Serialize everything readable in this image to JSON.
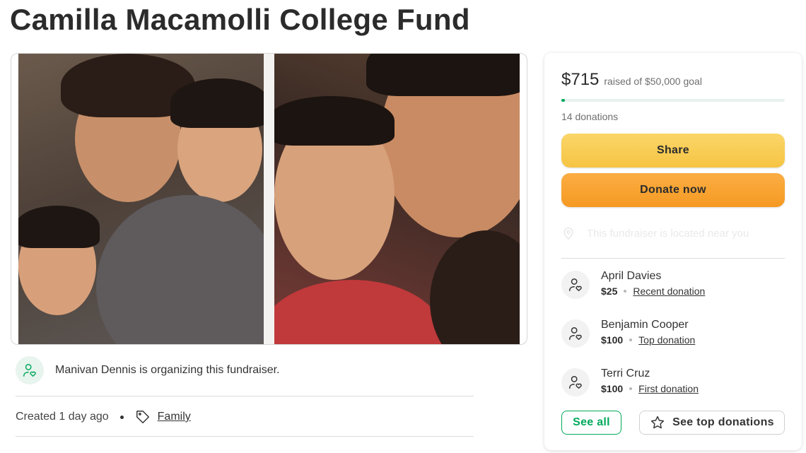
{
  "title": "Camilla Macamolli College Fund",
  "organizer": {
    "text": "Manivan Dennis is organizing this fundraiser."
  },
  "meta": {
    "created": "Created 1 day ago",
    "category": "Family"
  },
  "card": {
    "raised_amount": "$715",
    "raised_goal": "raised of $50,000 goal",
    "progress_fraction": 0.0143,
    "donations_count": "14 donations",
    "share_label": "Share",
    "donate_label": "Donate now",
    "location_text": "This fundraiser is located near you",
    "donors": [
      {
        "name": "April Davies",
        "amount": "$25",
        "kind": "Recent donation"
      },
      {
        "name": "Benjamin Cooper",
        "amount": "$100",
        "kind": "Top donation"
      },
      {
        "name": "Terri Cruz",
        "amount": "$100",
        "kind": "First donation"
      }
    ],
    "see_all_label": "See all",
    "see_top_label": "See top donations"
  },
  "colors": {
    "brand_green": "#02a95c",
    "share_yellow": "#f6c443",
    "donate_orange": "#f59a22"
  },
  "icons": {
    "organizer": "person-heart-icon",
    "tag": "tag-icon",
    "location": "location-pin-icon",
    "donor": "person-heart-icon",
    "star": "star-icon"
  }
}
